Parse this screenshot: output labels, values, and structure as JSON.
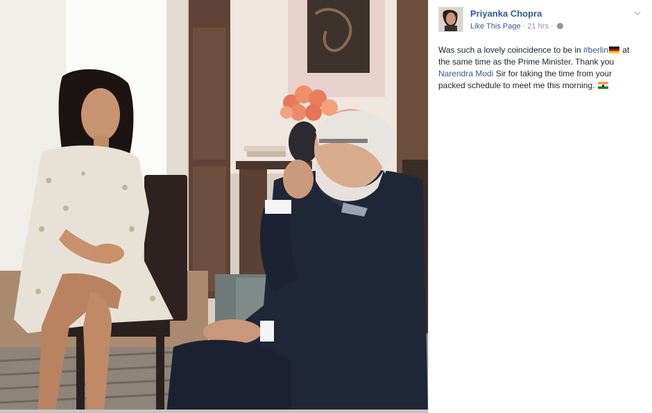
{
  "page": {
    "name": "Priyanka Chopra",
    "like_label": "Like This Page",
    "separator": "·",
    "time": "21 hrs"
  },
  "post": {
    "text_1": "Was such a lovely coincidence to be in ",
    "hashtag": "#berlin",
    "text_2": " at the same time as the Prime Minister. Thank you ",
    "mention": "Narendra Modi",
    "text_3": " Sir for taking the time from your packed schedule to meet me this morning. "
  },
  "colors": {
    "link": "#365899",
    "meta": "#90949c",
    "text": "#1d2129"
  },
  "icons": [
    "chevron-down-icon",
    "globe-icon",
    "germany-flag-icon",
    "india-flag-icon"
  ]
}
